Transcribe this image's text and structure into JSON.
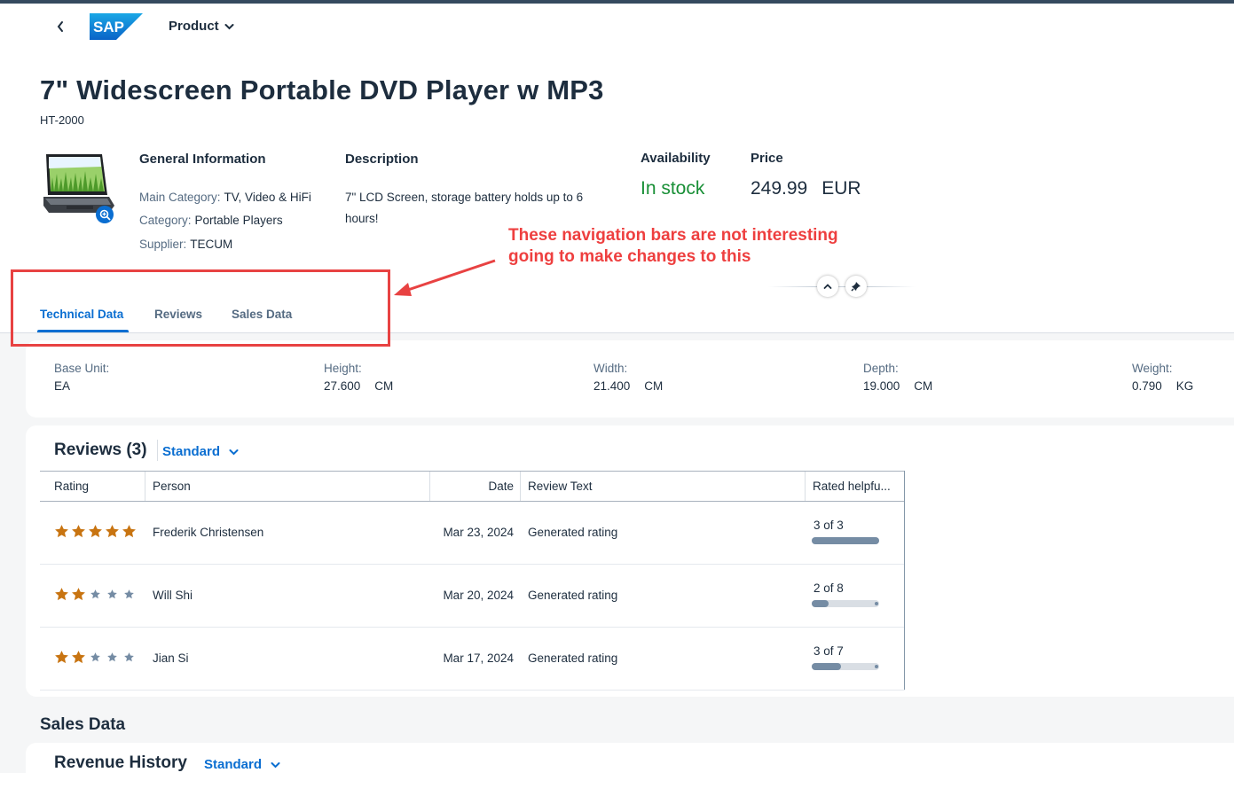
{
  "shell": {
    "product_menu": "Product"
  },
  "header": {
    "title": "7\" Widescreen Portable DVD Player w MP3",
    "product_id": "HT-2000",
    "general_info": {
      "heading": "General Information",
      "main_category_label": "Main Category:",
      "main_category_value": "TV, Video & HiFi",
      "category_label": "Category:",
      "category_value": "Portable Players",
      "supplier_label": "Supplier:",
      "supplier_value": "TECUM"
    },
    "description": {
      "heading": "Description",
      "text": "7\" LCD Screen, storage battery holds up to 6 hours!"
    },
    "availability": {
      "heading": "Availability",
      "value": "In stock",
      "color": "#188f36"
    },
    "price": {
      "heading": "Price",
      "amount": "249.99",
      "currency": "EUR"
    }
  },
  "annotation": {
    "line1": "These navigation bars are not interesting",
    "line2": "going to make changes to this",
    "color": "#ee3f3f"
  },
  "tabs": [
    {
      "label": "Technical Data",
      "active": true
    },
    {
      "label": "Reviews",
      "active": false
    },
    {
      "label": "Sales Data",
      "active": false
    }
  ],
  "technical_data": [
    {
      "label": "Base Unit:",
      "value": "EA",
      "unit": ""
    },
    {
      "label": "Height:",
      "value": "27.600",
      "unit": "CM"
    },
    {
      "label": "Width:",
      "value": "21.400",
      "unit": "CM"
    },
    {
      "label": "Depth:",
      "value": "19.000",
      "unit": "CM"
    },
    {
      "label": "Weight:",
      "value": "0.790",
      "unit": "KG"
    }
  ],
  "reviews": {
    "title": "Reviews (3)",
    "variant": "Standard",
    "columns": [
      "Rating",
      "Person",
      "Date",
      "Review Text",
      "Rated helpfu..."
    ],
    "rows": [
      {
        "rating": 5,
        "person": "Frederik Christensen",
        "date": "Mar 23, 2024",
        "text": "Generated rating",
        "helpful": "3 of 3",
        "helpful_fraction": 1.0
      },
      {
        "rating": 2,
        "person": "Will Shi",
        "date": "Mar 20, 2024",
        "text": "Generated rating",
        "helpful": "2 of 8",
        "helpful_fraction": 0.25
      },
      {
        "rating": 2,
        "person": "Jian Si",
        "date": "Mar 17, 2024",
        "text": "Generated rating",
        "helpful": "3 of 7",
        "helpful_fraction": 0.43
      }
    ]
  },
  "sales": {
    "heading": "Sales Data",
    "revenue_title": "Revenue History",
    "variant": "Standard"
  },
  "colors": {
    "accent": "#0a6ed1",
    "star_filled": "#c87411",
    "star_empty": "#758ca4"
  },
  "icons": {
    "back": "chevron-left-icon",
    "menu": "chevron-down-icon",
    "zoom": "zoom-in-icon",
    "collapse": "chevron-up-icon",
    "pin": "pin-icon",
    "star": "star-icon"
  }
}
